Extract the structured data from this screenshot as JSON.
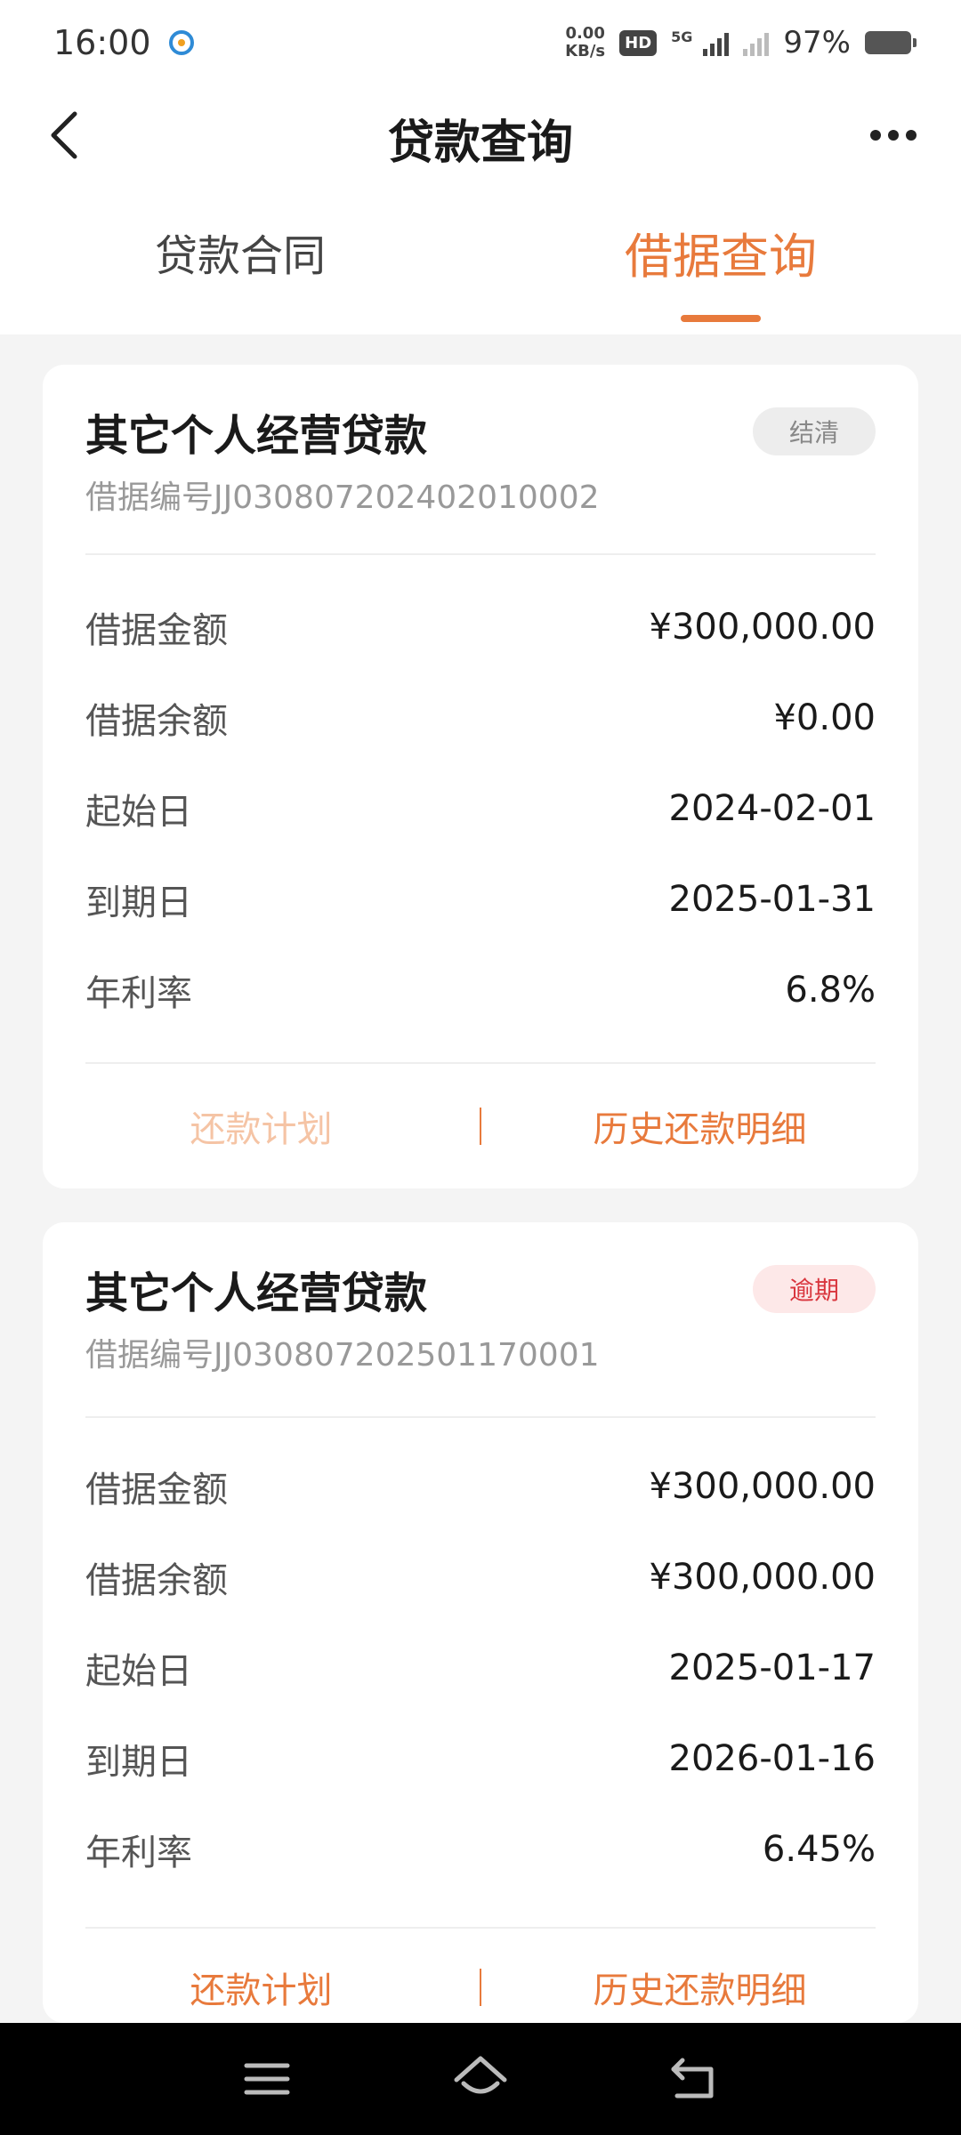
{
  "status_bar": {
    "time": "16:00",
    "net_speed_value": "0.00",
    "net_speed_unit": "KB/s",
    "hd_label": "HD",
    "network_type": "5G",
    "battery": "97%"
  },
  "navbar": {
    "title": "贷款查询"
  },
  "tabs": [
    {
      "label": "贷款合同",
      "active": false
    },
    {
      "label": "借据查询",
      "active": true
    }
  ],
  "loans": [
    {
      "title": "其它个人经营贷款",
      "status": "结清",
      "receipt_no": "借据编号JJ030807202402010002",
      "rows": [
        {
          "label": "借据金额",
          "value": "¥300,000.00"
        },
        {
          "label": "借据余额",
          "value": "¥0.00"
        },
        {
          "label": "起始日",
          "value": "2024-02-01"
        },
        {
          "label": "到期日",
          "value": "2025-01-31"
        },
        {
          "label": "年利率",
          "value": "6.8%"
        }
      ],
      "actions": {
        "plan": "还款计划",
        "history": "历史还款明细"
      }
    },
    {
      "title": "其它个人经营贷款",
      "status": "逾期",
      "receipt_no": "借据编号JJ030807202501170001",
      "rows": [
        {
          "label": "借据金额",
          "value": "¥300,000.00"
        },
        {
          "label": "借据余额",
          "value": "¥300,000.00"
        },
        {
          "label": "起始日",
          "value": "2025-01-17"
        },
        {
          "label": "到期日",
          "value": "2026-01-16"
        },
        {
          "label": "年利率",
          "value": "6.45%"
        }
      ],
      "actions": {
        "plan": "还款计划",
        "history": "历史还款明细"
      }
    }
  ],
  "colors": {
    "accent": "#e87a3c",
    "overdue": "#d9363e"
  }
}
